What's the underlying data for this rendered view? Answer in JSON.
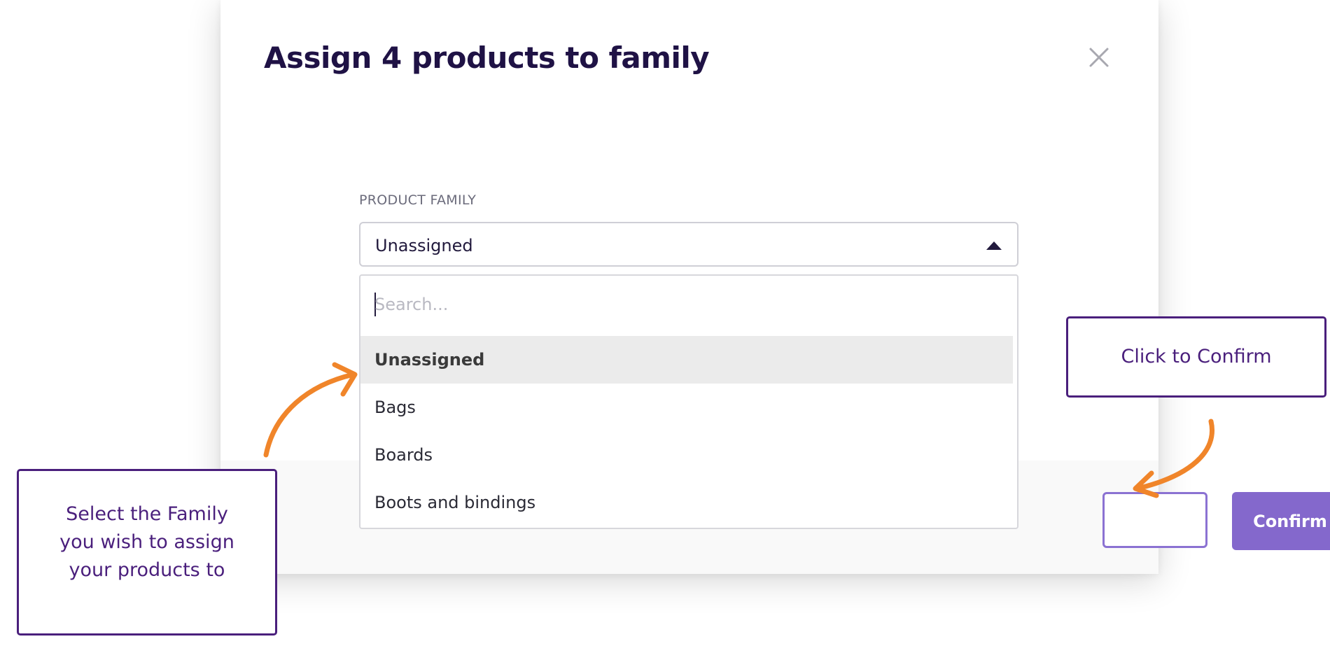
{
  "modal": {
    "title": "Assign 4 products to family",
    "close_icon": "close-icon"
  },
  "field": {
    "label": "PRODUCT FAMILY",
    "selected_value": "Unassigned",
    "caret_icon": "caret-up-icon"
  },
  "dropdown": {
    "search_placeholder": "Search...",
    "search_value": "",
    "options": [
      {
        "label": "Unassigned",
        "selected": true
      },
      {
        "label": "Bags",
        "selected": false
      },
      {
        "label": "Boards",
        "selected": false
      },
      {
        "label": "Boots and bindings",
        "selected": false
      }
    ]
  },
  "footer": {
    "confirm_label": "Confirm"
  },
  "callouts": {
    "left_lines": [
      "Select the Family",
      "you wish to assign",
      "your products to"
    ],
    "right": "Click to Confirm"
  },
  "colors": {
    "accent": "#8468cc",
    "callout_border": "#4a1f7c",
    "arrow": "#f0852a",
    "title": "#1f1245"
  }
}
